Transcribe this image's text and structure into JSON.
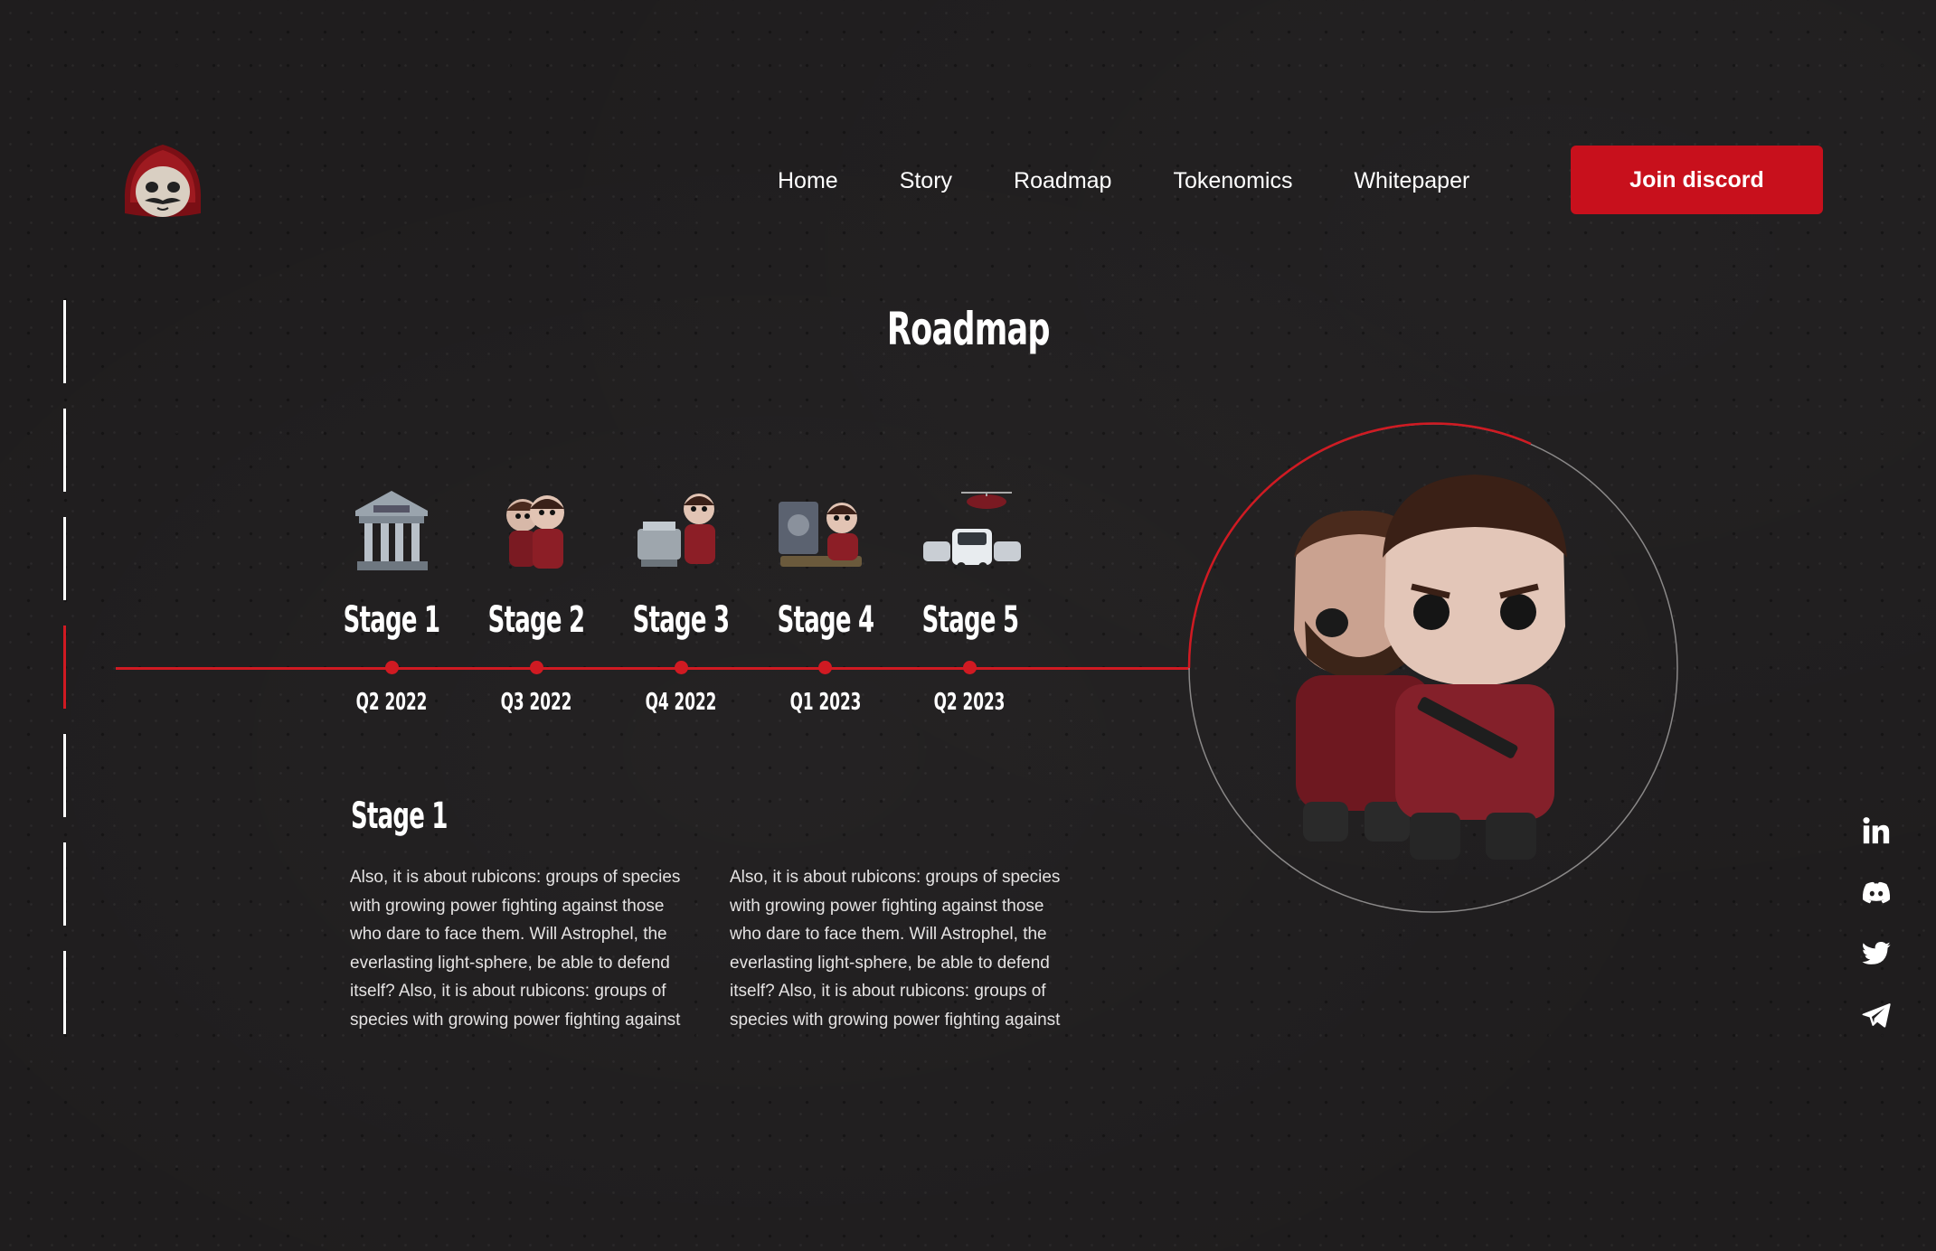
{
  "header": {
    "nav": [
      "Home",
      "Story",
      "Roadmap",
      "Tokenomics",
      "Whitepaper"
    ],
    "join_label": "Join discord"
  },
  "main": {
    "title": "Roadmap",
    "stages": [
      {
        "label": "Stage 1",
        "date": "Q2 2022",
        "icon": "bank-icon"
      },
      {
        "label": "Stage 2",
        "date": "Q3 2022",
        "icon": "robbers-duo-icon"
      },
      {
        "label": "Stage 3",
        "date": "Q4 2022",
        "icon": "money-printer-icon"
      },
      {
        "label": "Stage 4",
        "date": "Q1 2023",
        "icon": "vault-crew-icon"
      },
      {
        "label": "Stage 5",
        "date": "Q2 2023",
        "icon": "getaway-icon"
      }
    ],
    "active_stage": 1,
    "rail_active_index": 3,
    "detail": {
      "title": "Stage 1",
      "col1": "Also, it is about rubicons: groups of species with growing power fighting against those who dare to face them. Will Astrophel, the everlasting light-sphere, be able to defend itself? Also, it is about rubicons: groups of species with growing power fighting against",
      "col2": "Also, it is about rubicons: groups of species with growing power fighting against those who dare to face them. Will Astrophel, the everlasting light-sphere, be able to defend itself? Also, it is about rubicons: groups of species with growing power fighting against"
    }
  },
  "social": [
    "linkedin-icon",
    "discord-icon",
    "twitter-icon",
    "telegram-icon"
  ],
  "colors": {
    "background": "#1f1d1e",
    "accent": "#d01a22",
    "button": "#c8101c"
  }
}
